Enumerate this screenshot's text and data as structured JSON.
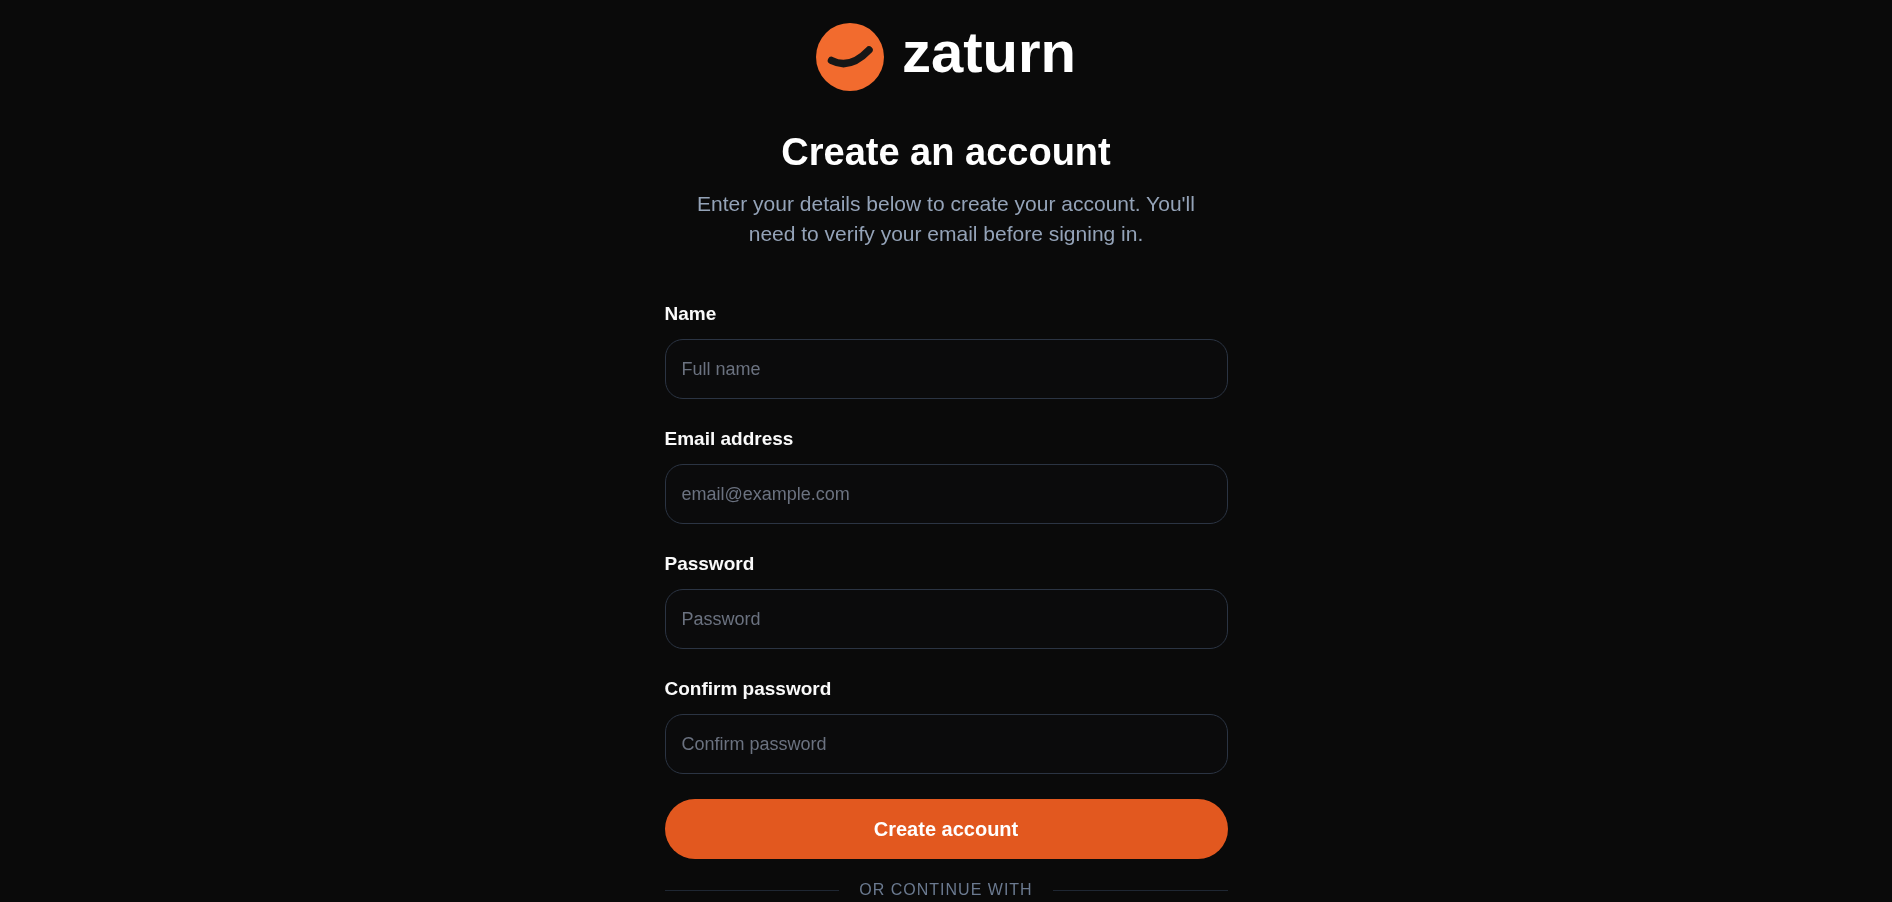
{
  "logo": {
    "wordmark": "zaturn"
  },
  "title": "Create an account",
  "subtitle": "Enter your details below to create your account. You'll need to verify your email before signing in.",
  "form": {
    "fields": [
      {
        "label": "Name",
        "placeholder": "Full name"
      },
      {
        "label": "Email address",
        "placeholder": "email@example.com"
      },
      {
        "label": "Password",
        "placeholder": "Password"
      },
      {
        "label": "Confirm password",
        "placeholder": "Confirm password"
      }
    ],
    "submit_label": "Create account"
  },
  "divider": {
    "label": "OR CONTINUE WITH"
  }
}
